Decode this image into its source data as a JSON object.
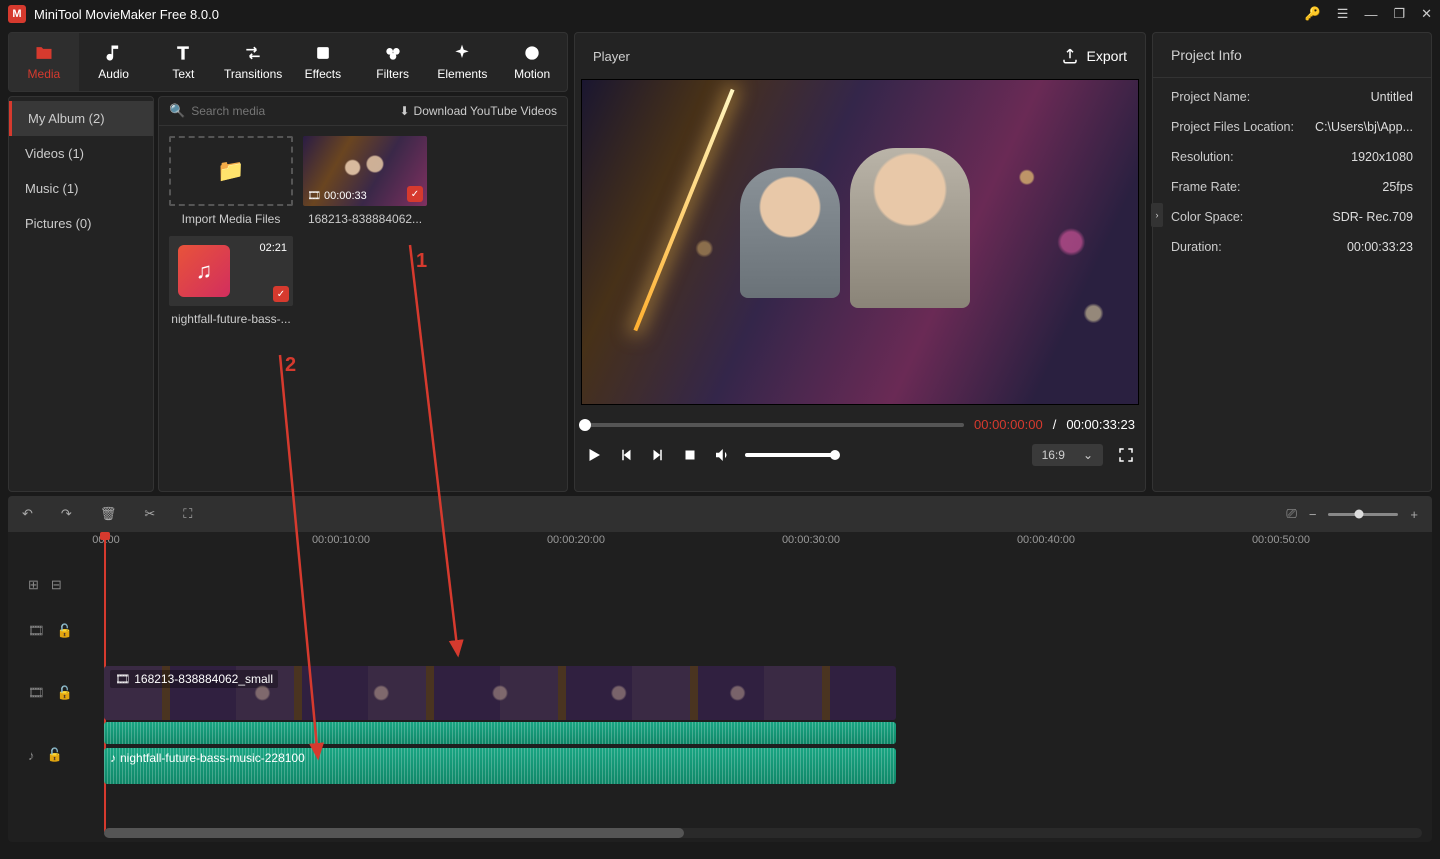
{
  "app": {
    "title": "MiniTool MovieMaker Free 8.0.0"
  },
  "tabs": [
    {
      "label": "Media",
      "icon": "folder",
      "active": true
    },
    {
      "label": "Audio",
      "icon": "music"
    },
    {
      "label": "Text",
      "icon": "text"
    },
    {
      "label": "Transitions",
      "icon": "arrows"
    },
    {
      "label": "Effects",
      "icon": "fx"
    },
    {
      "label": "Filters",
      "icon": "sliders"
    },
    {
      "label": "Elements",
      "icon": "sparkle"
    },
    {
      "label": "Motion",
      "icon": "circle"
    }
  ],
  "sidebar": {
    "items": [
      {
        "label": "My Album (2)",
        "active": true
      },
      {
        "label": "Videos (1)"
      },
      {
        "label": "Music (1)"
      },
      {
        "label": "Pictures (0)"
      }
    ]
  },
  "grid": {
    "search_placeholder": "Search media",
    "download_label": "Download YouTube Videos",
    "items": [
      {
        "type": "import",
        "label": "Import Media Files"
      },
      {
        "type": "video",
        "label": "168213-838884062...",
        "duration": "00:00:33",
        "checked": true
      },
      {
        "type": "music",
        "label": "nightfall-future-bass-...",
        "duration": "02:21",
        "checked": true
      }
    ]
  },
  "player": {
    "title": "Player",
    "export": "Export",
    "time_current": "00:00:00:00",
    "time_total": "00:00:33:23",
    "aspect": "16:9"
  },
  "project": {
    "title": "Project Info",
    "rows": [
      {
        "k": "Project Name:",
        "v": "Untitled"
      },
      {
        "k": "Project Files Location:",
        "v": "C:\\Users\\bj\\App..."
      },
      {
        "k": "Resolution:",
        "v": "1920x1080"
      },
      {
        "k": "Frame Rate:",
        "v": "25fps"
      },
      {
        "k": "Color Space:",
        "v": "SDR- Rec.709"
      },
      {
        "k": "Duration:",
        "v": "00:00:33:23"
      }
    ]
  },
  "timeline": {
    "ticks": [
      "00:00",
      "00:00:10:00",
      "00:00:20:00",
      "00:00:30:00",
      "00:00:40:00",
      "00:00:50:00"
    ],
    "video_clip_label": "168213-838884062_small",
    "audio_clip_label": "nightfall-future-bass-music-228100"
  },
  "annotations": {
    "n1": "1",
    "n2": "2"
  }
}
